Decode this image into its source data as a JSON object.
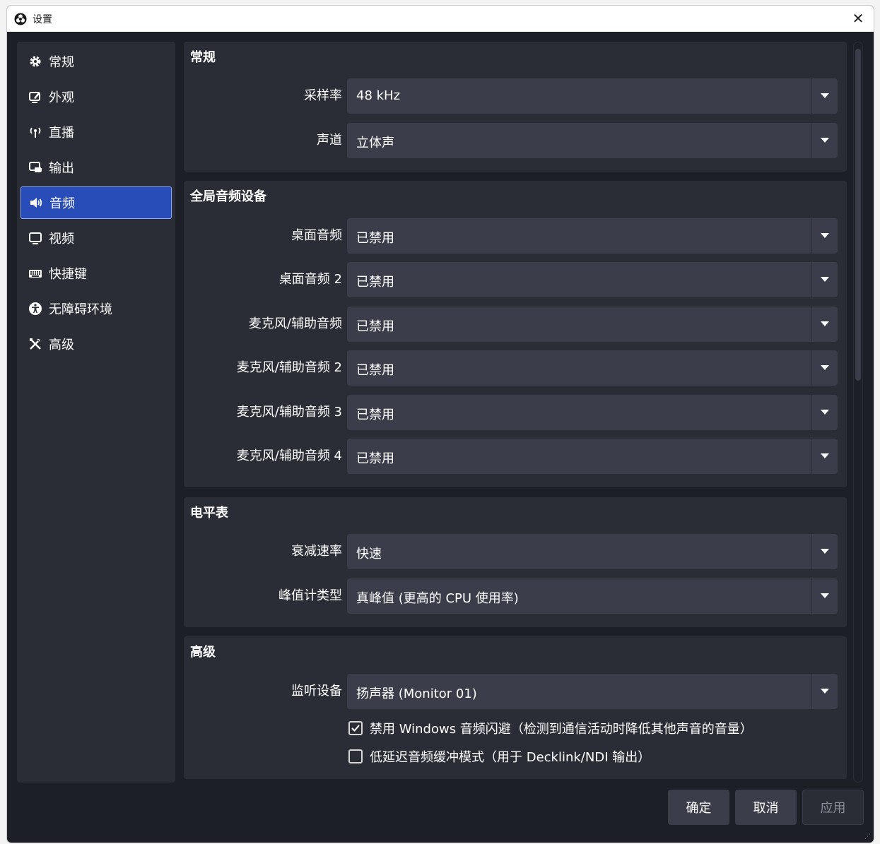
{
  "window": {
    "title": "设置",
    "close_label": "✕"
  },
  "sidebar": {
    "items": [
      {
        "label": "常规",
        "icon": "gear-icon"
      },
      {
        "label": "外观",
        "icon": "appearance-icon"
      },
      {
        "label": "直播",
        "icon": "antenna-icon"
      },
      {
        "label": "输出",
        "icon": "output-icon"
      },
      {
        "label": "音频",
        "icon": "speaker-icon",
        "active": true
      },
      {
        "label": "视频",
        "icon": "monitor-icon"
      },
      {
        "label": "快捷键",
        "icon": "keyboard-icon"
      },
      {
        "label": "无障碍环境",
        "icon": "accessibility-icon"
      },
      {
        "label": "高级",
        "icon": "tools-icon"
      }
    ]
  },
  "general": {
    "title": "常规",
    "sample_rate_label": "采样率",
    "sample_rate_value": "48 kHz",
    "channels_label": "声道",
    "channels_value": "立体声"
  },
  "global_audio": {
    "title": "全局音频设备",
    "devices": [
      {
        "label": "桌面音频",
        "value": "已禁用"
      },
      {
        "label": "桌面音频 2",
        "value": "已禁用"
      },
      {
        "label": "麦克风/辅助音频",
        "value": "已禁用"
      },
      {
        "label": "麦克风/辅助音频 2",
        "value": "已禁用"
      },
      {
        "label": "麦克风/辅助音频 3",
        "value": "已禁用"
      },
      {
        "label": "麦克风/辅助音频 4",
        "value": "已禁用"
      }
    ]
  },
  "meters": {
    "title": "电平表",
    "decay_label": "衰减速率",
    "decay_value": "快速",
    "peak_label": "峰值计类型",
    "peak_value": "真峰值 (更高的 CPU 使用率)"
  },
  "advanced": {
    "title": "高级",
    "monitor_label": "监听设备",
    "monitor_value": "扬声器 (Monitor 01)",
    "ducking_label": "禁用 Windows 音频闪避（检测到通信活动时降低其他声音的音量）",
    "ducking_checked": true,
    "low_latency_label": "低延迟音频缓冲模式（用于 Decklink/NDI 输出）",
    "low_latency_checked": false
  },
  "buttons": {
    "ok": "确定",
    "cancel": "取消",
    "apply": "应用"
  },
  "colors": {
    "background": "#1d1f26",
    "panel": "#2a2d36",
    "input": "#3b3e4a",
    "accent": "#284cb8"
  }
}
